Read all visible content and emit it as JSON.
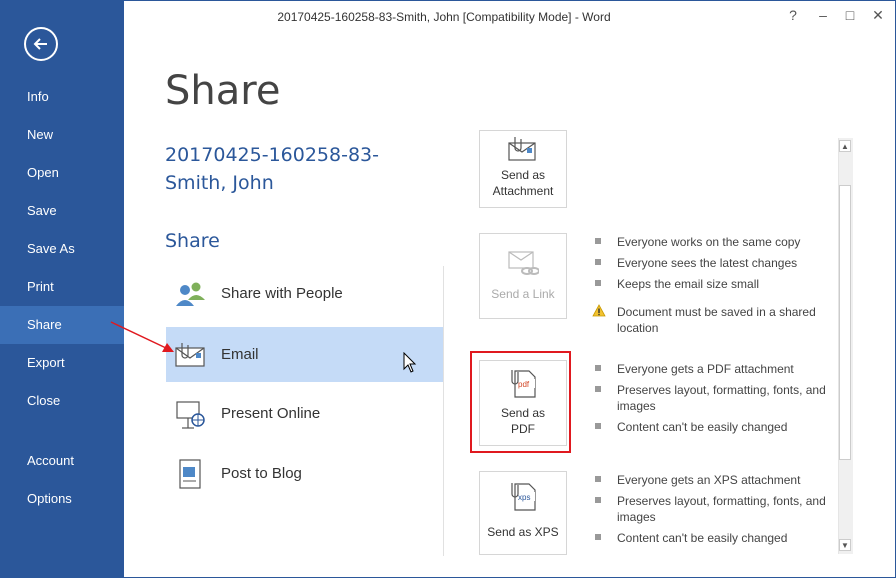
{
  "window": {
    "title": "20170425-160258-83-Smith, John [Compatibility Mode] - Word",
    "help": "?",
    "minimize": "–",
    "maximize": "□",
    "close": "✕"
  },
  "sidebar": {
    "back_icon": "back-arrow-icon",
    "items": [
      {
        "label": "Info"
      },
      {
        "label": "New"
      },
      {
        "label": "Open"
      },
      {
        "label": "Save"
      },
      {
        "label": "Save As"
      },
      {
        "label": "Print"
      },
      {
        "label": "Share",
        "selected": true
      },
      {
        "label": "Export"
      },
      {
        "label": "Close"
      },
      {
        "label": "Account"
      },
      {
        "label": "Options"
      }
    ]
  },
  "main": {
    "title": "Share",
    "doc_name": "20170425-160258-83-Smith, John",
    "section": "Share",
    "options": [
      {
        "label": "Share with People",
        "icon": "people-icon"
      },
      {
        "label": "Email",
        "icon": "email-icon",
        "selected": true
      },
      {
        "label": "Present Online",
        "icon": "present-online-icon"
      },
      {
        "label": "Post to Blog",
        "icon": "blog-icon"
      }
    ]
  },
  "panel": {
    "attachment": {
      "label_1": "Send as",
      "label_2": "Attachment"
    },
    "link": {
      "label": "Send a Link",
      "disabled": true
    },
    "link_bullets": [
      "Everyone works on the same copy",
      "Everyone sees the latest changes",
      "Keeps the email size small"
    ],
    "link_warning": "Document must be saved in a shared location",
    "pdf": {
      "label_1": "Send as",
      "label_2": "PDF",
      "file_badge": "pdf"
    },
    "pdf_bullets": [
      "Everyone gets a PDF attachment",
      "Preserves layout, formatting, fonts, and images",
      "Content can't be easily changed"
    ],
    "xps": {
      "label": "Send as XPS",
      "file_badge": "xps"
    },
    "xps_bullets": [
      "Everyone gets an XPS attachment",
      "Preserves layout, formatting, fonts, and images",
      "Content can't be easily changed"
    ]
  },
  "colors": {
    "sidebar": "#2b579a",
    "accent": "#2b579a",
    "selected_option": "#c5dbf7",
    "highlight": "#e0191f"
  }
}
